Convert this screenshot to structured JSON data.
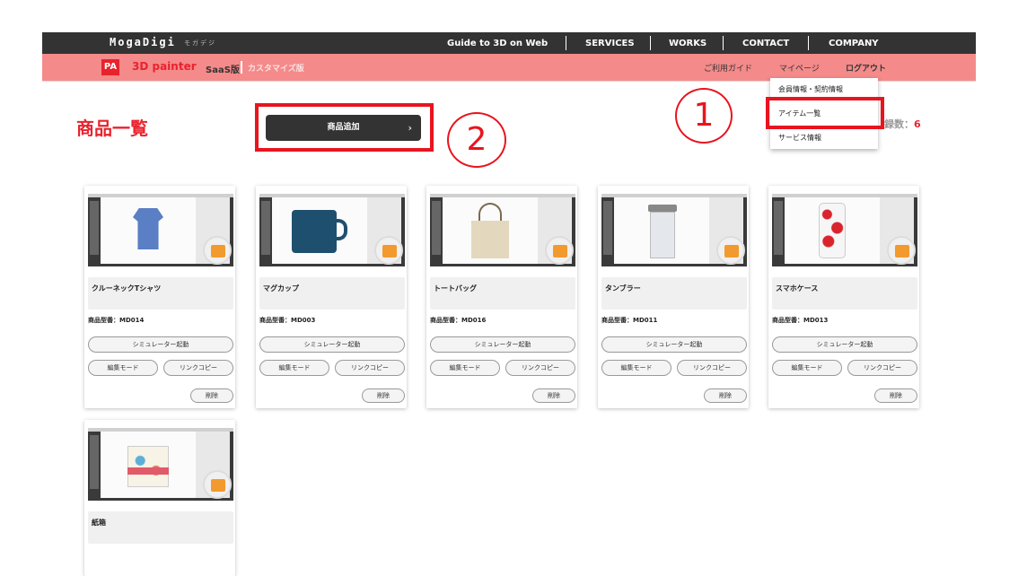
{
  "header": {
    "logo": "MogaDigi",
    "logo_kana": "モガデジ",
    "nav": [
      "Guide to 3D on Web",
      "SERVICES",
      "WORKS",
      "CONTACT",
      "COMPANY"
    ]
  },
  "subheader": {
    "badge": "PA",
    "brand": "3D painter",
    "edition": "SaaS版",
    "edition2": "カスタマイズ版",
    "links": [
      "ご利用ガイド",
      "マイページ",
      "ログアウト"
    ]
  },
  "dropdown": {
    "items": [
      "会員情報・契約情報",
      "アイテム一覧",
      "サービス情報"
    ]
  },
  "page": {
    "title": "商品一覧",
    "add_button": "商品追加",
    "add_chevron": "›",
    "count_label": "録数：",
    "count_value": "6"
  },
  "annotations": {
    "one": "1",
    "two": "2"
  },
  "products": [
    {
      "name": "クルーネックTシャツ",
      "code": "商品型番：MD014",
      "simulate": "シミュレーター起動",
      "edit": "編集モード",
      "copy_link": "リンクコピー",
      "delete": "削除"
    },
    {
      "name": "マグカップ",
      "code": "商品型番：MD003",
      "simulate": "シミュレーター起動",
      "edit": "編集モード",
      "copy_link": "リンクコピー",
      "delete": "削除"
    },
    {
      "name": "トートバッグ",
      "code": "商品型番：MD016",
      "simulate": "シミュレーター起動",
      "edit": "編集モード",
      "copy_link": "リンクコピー",
      "delete": "削除"
    },
    {
      "name": "タンブラー",
      "code": "商品型番：MD011",
      "simulate": "シミュレーター起動",
      "edit": "編集モード",
      "copy_link": "リンクコピー",
      "delete": "削除"
    },
    {
      "name": "スマホケース",
      "code": "商品型番：MD013",
      "simulate": "シミュレーター起動",
      "edit": "編集モード",
      "copy_link": "リンクコピー",
      "delete": "削除"
    },
    {
      "name": "紙箱"
    }
  ],
  "colors": {
    "accent": "#e8232d",
    "pink_bar": "#f48a8a",
    "dark_bar": "#333333",
    "annotation": "#e8141e"
  }
}
